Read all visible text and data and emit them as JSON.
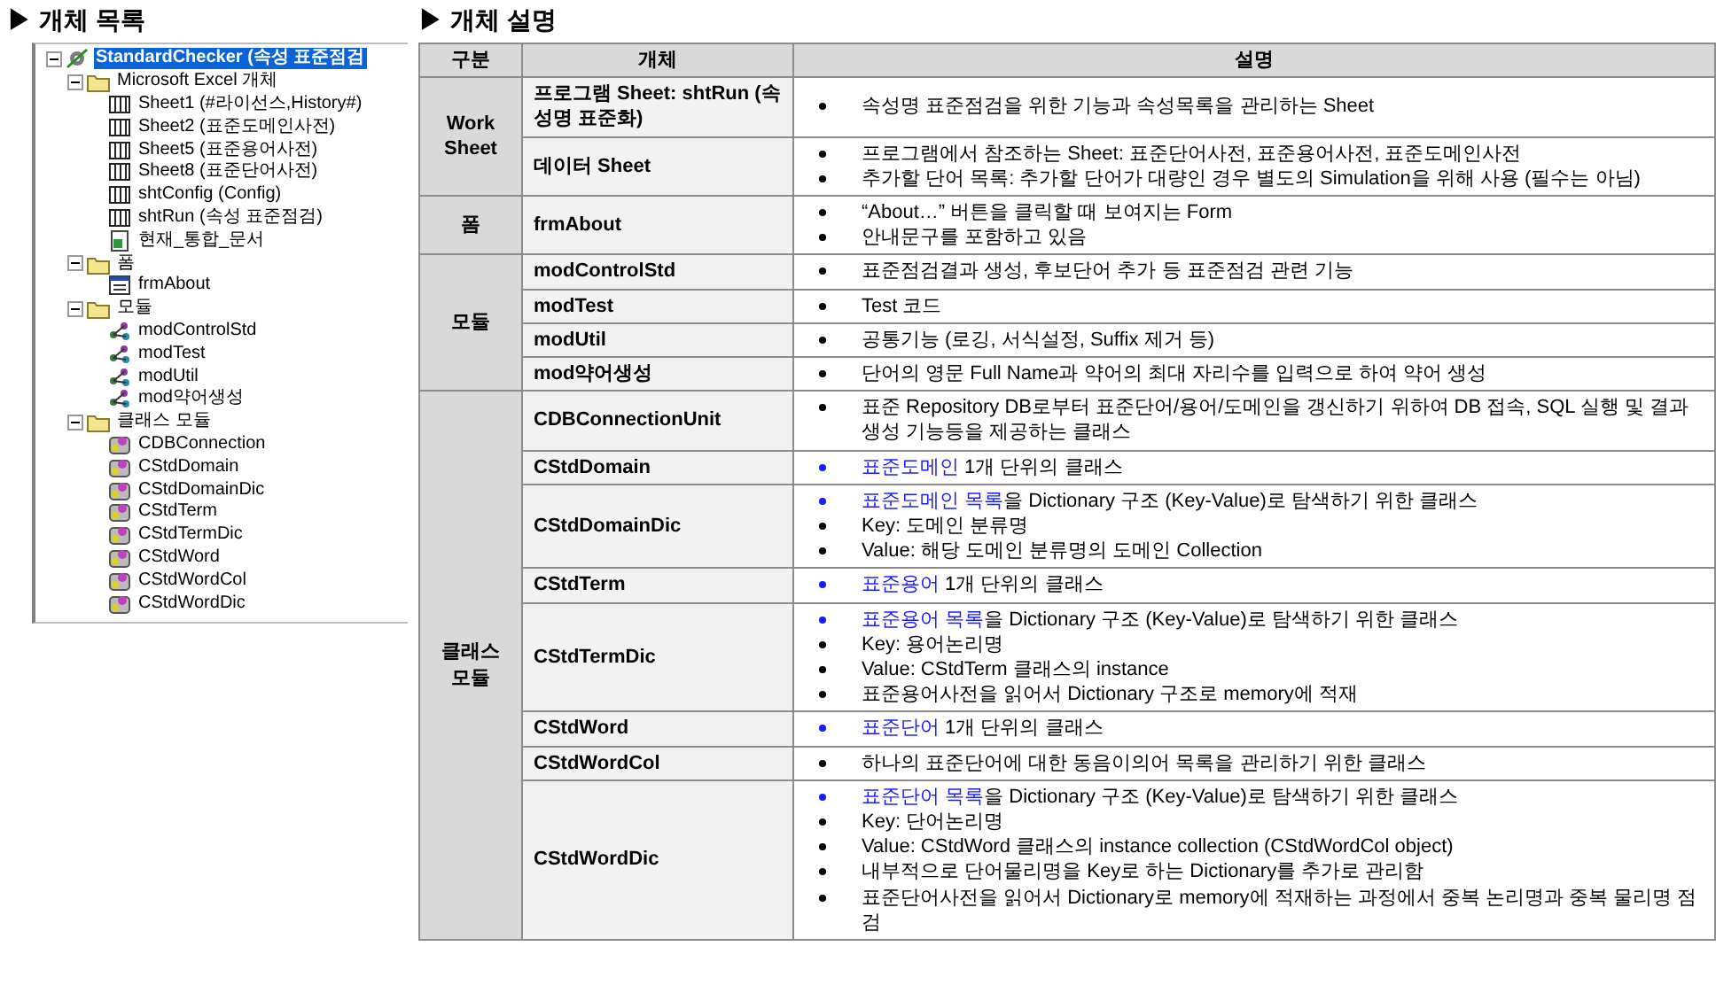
{
  "tree_panel": {
    "title": "▶ 개체 목록",
    "items": [
      {
        "label": "StandardChecker (속성 표준점검",
        "kind": "project",
        "selected": true,
        "expanded": true,
        "children": [
          {
            "label": "Microsoft Excel 개체",
            "kind": "folder",
            "selected": false,
            "expanded": true,
            "children": [
              {
                "label": "Sheet1 (#라이선스,History#)",
                "kind": "sheet",
                "selected": false
              },
              {
                "label": "Sheet2 (표준도메인사전)",
                "kind": "sheet",
                "selected": false
              },
              {
                "label": "Sheet5 (표준용어사전)",
                "kind": "sheet",
                "selected": false
              },
              {
                "label": "Sheet8 (표준단어사전)",
                "kind": "sheet",
                "selected": false
              },
              {
                "label": "shtConfig (Config)",
                "kind": "sheet",
                "selected": false
              },
              {
                "label": "shtRun (속성 표준점검)",
                "kind": "sheet",
                "selected": false
              },
              {
                "label": "현재_통합_문서",
                "kind": "workbook",
                "selected": false
              }
            ]
          },
          {
            "label": "폼",
            "kind": "folder",
            "selected": false,
            "expanded": true,
            "children": [
              {
                "label": "frmAbout",
                "kind": "form",
                "selected": false
              }
            ]
          },
          {
            "label": "모듈",
            "kind": "folder",
            "selected": false,
            "expanded": true,
            "children": [
              {
                "label": "modControlStd",
                "kind": "module",
                "selected": false
              },
              {
                "label": "modTest",
                "kind": "module",
                "selected": false
              },
              {
                "label": "modUtil",
                "kind": "module",
                "selected": false
              },
              {
                "label": "mod약어생성",
                "kind": "module",
                "selected": false
              }
            ]
          },
          {
            "label": "클래스 모듈",
            "kind": "folder",
            "selected": false,
            "expanded": true,
            "children": [
              {
                "label": "CDBConnection",
                "kind": "class",
                "selected": false
              },
              {
                "label": "CStdDomain",
                "kind": "class",
                "selected": false
              },
              {
                "label": "CStdDomainDic",
                "kind": "class",
                "selected": false
              },
              {
                "label": "CStdTerm",
                "kind": "class",
                "selected": false
              },
              {
                "label": "CStdTermDic",
                "kind": "class",
                "selected": false
              },
              {
                "label": "CStdWord",
                "kind": "class",
                "selected": false
              },
              {
                "label": "CStdWordCol",
                "kind": "class",
                "selected": false
              },
              {
                "label": "CStdWordDic",
                "kind": "class",
                "selected": false
              }
            ]
          }
        ]
      }
    ]
  },
  "description_panel": {
    "title": "▶ 개체 설명",
    "table": {
      "columns": [
        "구분",
        "개체",
        "설명"
      ],
      "groups": [
        {
          "label": "Work\nSheet",
          "rows": [
            {
              "name": "프로그램 Sheet: shtRun (속성명 표준화)",
              "bullets": [
                {
                  "text": "속성명 표준점검을 위한 기능과 속성목록을 관리하는 Sheet"
                }
              ]
            },
            {
              "name": "데이터 Sheet",
              "bullets": [
                {
                  "text": "프로그램에서 참조하는 Sheet: 표준단어사전, 표준용어사전, 표준도메인사전"
                },
                {
                  "text": "추가할 단어 목록: 추가할 단어가 대량인 경우 별도의 Simulation을 위해 사용 (필수는 아님)"
                }
              ]
            }
          ]
        },
        {
          "label": "폼",
          "rows": [
            {
              "name": "frmAbout",
              "bullets": [
                {
                  "text": "“About…” 버튼을 클릭할 때 보여지는 Form"
                },
                {
                  "text": "안내문구를 포함하고 있음"
                }
              ]
            }
          ]
        },
        {
          "label": "모듈",
          "rows": [
            {
              "name": "modControlStd",
              "bullets": [
                {
                  "text": "표준점검결과 생성, 후보단어 추가 등 표준점검 관련 기능"
                }
              ]
            },
            {
              "name": "modTest",
              "bullets": [
                {
                  "text": "Test 코드"
                }
              ]
            },
            {
              "name": "modUtil",
              "bullets": [
                {
                  "text": "공통기능 (로깅, 서식설정, Suffix 제거 등)"
                }
              ]
            },
            {
              "name": "mod약어생성",
              "bullets": [
                {
                  "text": "단어의 영문 Full Name과 약어의 최대 자리수를 입력으로 하여 약어 생성"
                }
              ]
            }
          ]
        },
        {
          "label": "클래스\n모듈",
          "rows": [
            {
              "name": "CDBConnectionUnit",
              "bullets": [
                {
                  "text": "표준 Repository DB로부터 표준단어/용어/도메인을 갱신하기 위하여 DB 접속, SQL 실행 및 결과 생성 기능등을 제공하는 클래스"
                }
              ]
            },
            {
              "name": "CStdDomain",
              "bullets": [
                {
                  "lead": "표준도메인",
                  "text": " 1개 단위의 클래스"
                }
              ]
            },
            {
              "name": "CStdDomainDic",
              "bullets": [
                {
                  "lead": "표준도메인 목록",
                  "text": "을 Dictionary 구조 (Key-Value)로 탐색하기 위한 클래스"
                },
                {
                  "text": "Key: 도메인 분류명"
                },
                {
                  "text": "Value: 해당 도메인 분류명의 도메인 Collection"
                }
              ]
            },
            {
              "name": "CStdTerm",
              "bullets": [
                {
                  "lead": "표준용어",
                  "text": " 1개 단위의 클래스"
                }
              ]
            },
            {
              "name": "CStdTermDic",
              "bullets": [
                {
                  "lead": "표준용어 목록",
                  "text": "을 Dictionary 구조 (Key-Value)로 탐색하기 위한 클래스"
                },
                {
                  "text": "Key: 용어논리명"
                },
                {
                  "text": "Value: CStdTerm 클래스의 instance"
                },
                {
                  "text": "표준용어사전을 읽어서 Dictionary 구조로 memory에 적재"
                }
              ]
            },
            {
              "name": "CStdWord",
              "bullets": [
                {
                  "lead": "표준단어",
                  "text": " 1개 단위의 클래스"
                }
              ]
            },
            {
              "name": "CStdWordCol",
              "bullets": [
                {
                  "text": "하나의 표준단어에 대한 동음이의어 목록을 관리하기 위한 클래스"
                }
              ]
            },
            {
              "name": "CStdWordDic",
              "bullets": [
                {
                  "lead": "표준단어 목록",
                  "text": "을 Dictionary 구조 (Key-Value)로 탐색하기 위한 클래스"
                },
                {
                  "text": "Key: 단어논리명"
                },
                {
                  "text": "Value: CStdWord 클래스의 instance collection (CStdWordCol object)"
                },
                {
                  "text": "내부적으로 단어물리명을 Key로 하는 Dictionary를 추가로 관리함"
                },
                {
                  "text": "표준단어사전을 읽어서 Dictionary로 memory에 적재하는 과정에서 중복 논리명과 중복 물리명 점검"
                }
              ]
            }
          ]
        }
      ]
    }
  }
}
